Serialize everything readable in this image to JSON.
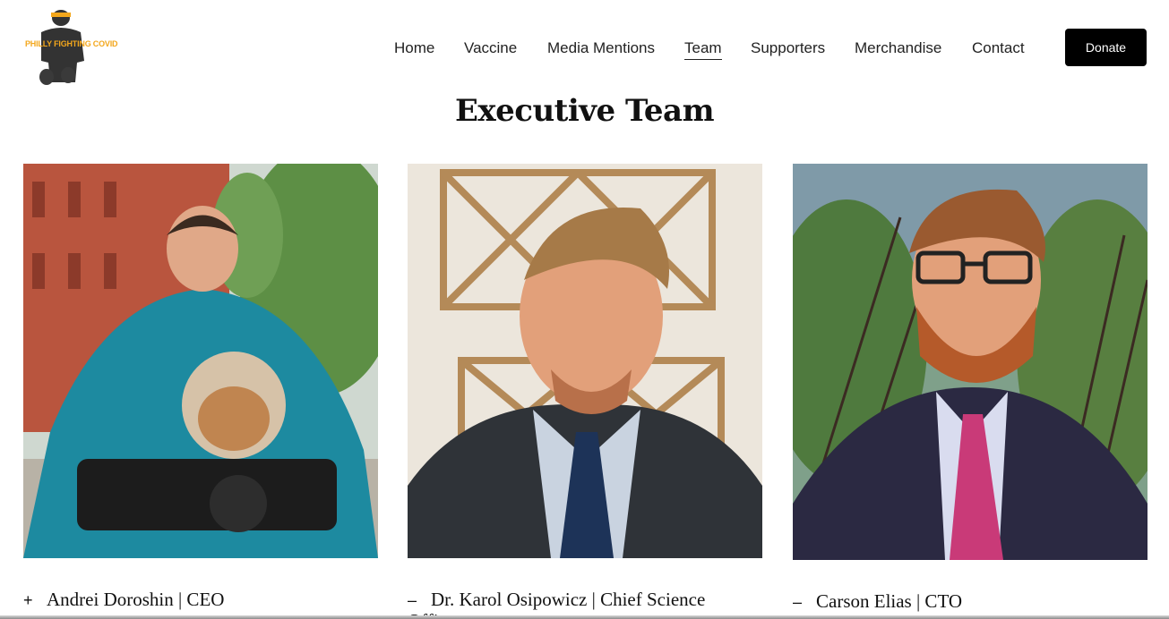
{
  "brand": {
    "logo_text": "PHILLY FIGHTING COVID",
    "accent": "#f3a71c"
  },
  "nav": {
    "items": [
      {
        "label": "Home"
      },
      {
        "label": "Vaccine"
      },
      {
        "label": "Media Mentions"
      },
      {
        "label": "Team",
        "active": true
      },
      {
        "label": "Supporters"
      },
      {
        "label": "Merchandise"
      },
      {
        "label": "Contact"
      }
    ],
    "donate_label": "Donate"
  },
  "section": {
    "title": "Executive Team"
  },
  "team": [
    {
      "toggle": "+",
      "caption": "Andrei Doroshin | CEO",
      "overflow": "",
      "photo": "man-with-bulldog-on-motorcycle"
    },
    {
      "toggle": "–",
      "caption": "Dr. Karol Osipowicz | Chief Science",
      "overflow": "Offi",
      "photo": "man-in-suit-blue-tie"
    },
    {
      "toggle": "–",
      "caption": "Carson Elias | CTO",
      "overflow": "",
      "photo": "bearded-man-glasses-pink-tie"
    }
  ]
}
